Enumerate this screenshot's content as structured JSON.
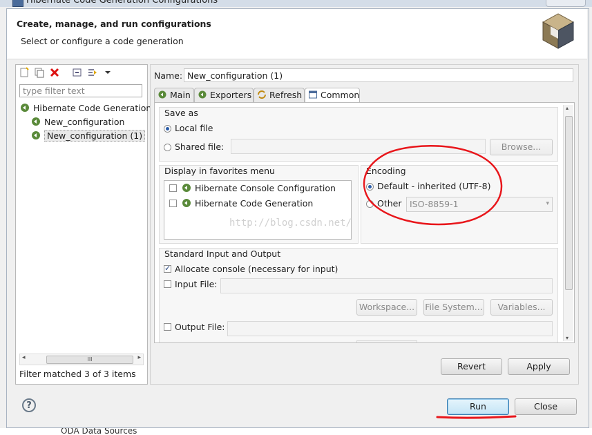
{
  "window": {
    "title": "Hibernate Code Generation Configurations"
  },
  "header": {
    "title": "Create, manage, and run configurations",
    "subtitle": "Select or configure a code generation"
  },
  "left": {
    "filter_placeholder": "type filter text",
    "tree": [
      {
        "label": "Hibernate Code Generation",
        "level": 0
      },
      {
        "label": "New_configuration",
        "level": 1
      },
      {
        "label": "New_configuration (1)",
        "level": 1,
        "selected": true
      }
    ],
    "scroll_thumb": "III",
    "status": "Filter matched 3 of 3 items"
  },
  "config": {
    "name_label": "Name:",
    "name_value": "New_configuration (1)",
    "tabs": [
      {
        "label": "Main",
        "icon": "hibernate-icon"
      },
      {
        "label": "Exporters",
        "icon": "hibernate-icon"
      },
      {
        "label": "Refresh",
        "icon": "refresh-icon"
      },
      {
        "label": "Common",
        "icon": "common-tab-icon",
        "active": true
      }
    ],
    "save_as": {
      "title": "Save as",
      "local": "Local file",
      "shared": "Shared file:",
      "browse": "Browse..."
    },
    "favorites": {
      "title": "Display in favorites menu",
      "items": [
        "Hibernate Console Configuration",
        "Hibernate Code Generation"
      ]
    },
    "encoding": {
      "title": "Encoding",
      "default": "Default - inherited (UTF-8)",
      "other": "Other",
      "other_value": "ISO-8859-1"
    },
    "stdio": {
      "title": "Standard Input and Output",
      "allocate": "Allocate console (necessary for input)",
      "input_file": "Input File:",
      "workspace": "Workspace...",
      "file_system": "File System...",
      "variables": "Variables...",
      "output_file": "Output File:"
    },
    "watermark": "http://blog.csdn.net/",
    "revert": "Revert",
    "apply": "Apply"
  },
  "footer": {
    "help": "?",
    "run": "Run",
    "close": "Close"
  },
  "background_text": "ODA Data Sources",
  "colors": {
    "annotation_red": "#e8161b",
    "default_button_border": "#3c7fb1"
  }
}
